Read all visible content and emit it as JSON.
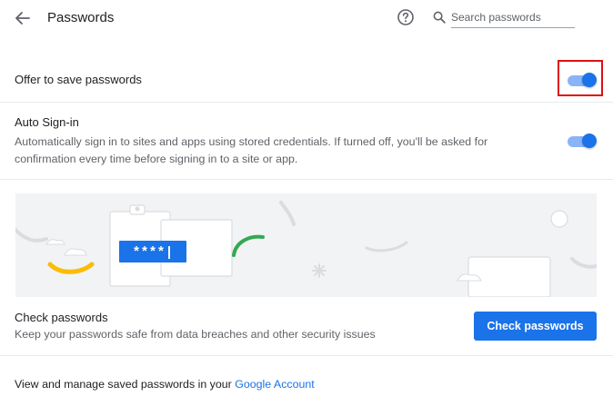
{
  "header": {
    "title": "Passwords",
    "search_placeholder": "Search passwords",
    "back_icon": "arrow-left-icon",
    "help_icon": "help-circle-icon",
    "search_icon": "search-icon"
  },
  "offer_to_save": {
    "label": "Offer to save passwords",
    "enabled": true
  },
  "auto_signin": {
    "title": "Auto Sign-in",
    "description": "Automatically sign in to sites and apps using stored credentials. If turned off, you'll be asked for confirmation every time before signing in to a site or app.",
    "enabled": true
  },
  "illustration": {
    "password_mask": "****|"
  },
  "check_passwords": {
    "title": "Check passwords",
    "description": "Keep your passwords safe from data breaches and other security issues",
    "button_label": "Check passwords"
  },
  "manage": {
    "prefix": "View and manage saved passwords in your ",
    "link_text": "Google Account"
  },
  "colors": {
    "accent": "#1a73e8",
    "toggle_track": "#8ab4f8",
    "highlight": "#dd1111"
  }
}
